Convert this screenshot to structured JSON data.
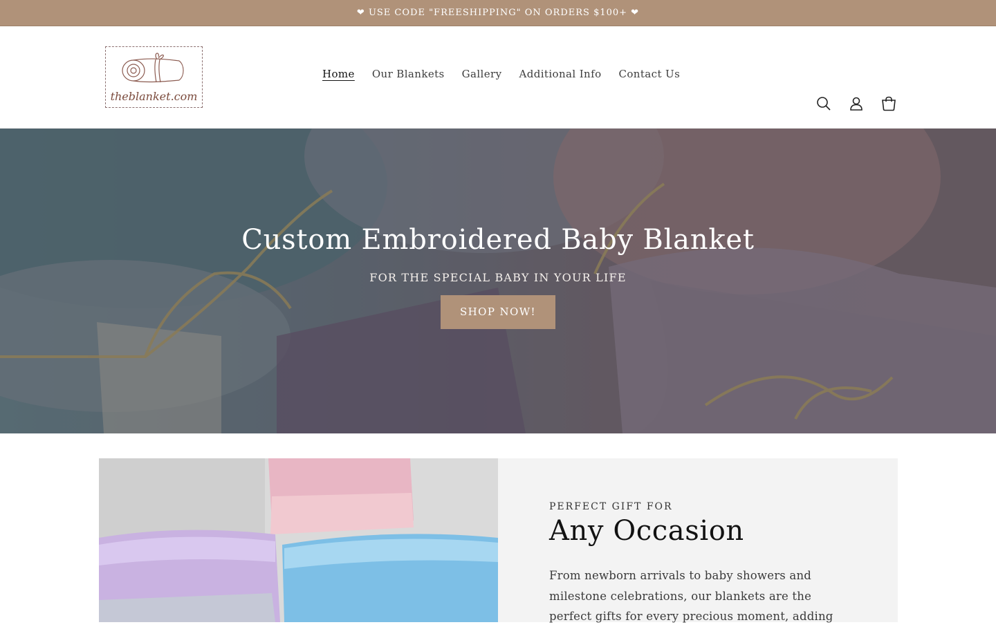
{
  "announcement": "❤ USE CODE \"FREESHIPPING\" ON ORDERS $100+ ❤",
  "logo": {
    "text": "theblanket.com"
  },
  "nav": {
    "items": [
      "Home",
      "Our Blankets",
      "Gallery",
      "Additional Info",
      "Contact Us"
    ],
    "active": "Home"
  },
  "header_icons": [
    "search-icon",
    "account-icon",
    "cart-icon"
  ],
  "hero": {
    "title": "Custom Embroidered Baby Blanket",
    "subtitle": "FOR THE SPECIAL BABY IN YOUR LIFE",
    "button": "SHOP NOW!"
  },
  "feature": {
    "kicker": "PERFECT GIFT FOR",
    "title": "Any Occasion",
    "body": "From newborn arrivals to baby showers and milestone celebrations, our blankets are the perfect gifts for every precious moment, adding"
  },
  "colors": {
    "accent": "#b09279",
    "feature_bg": "#f3f3f3"
  }
}
